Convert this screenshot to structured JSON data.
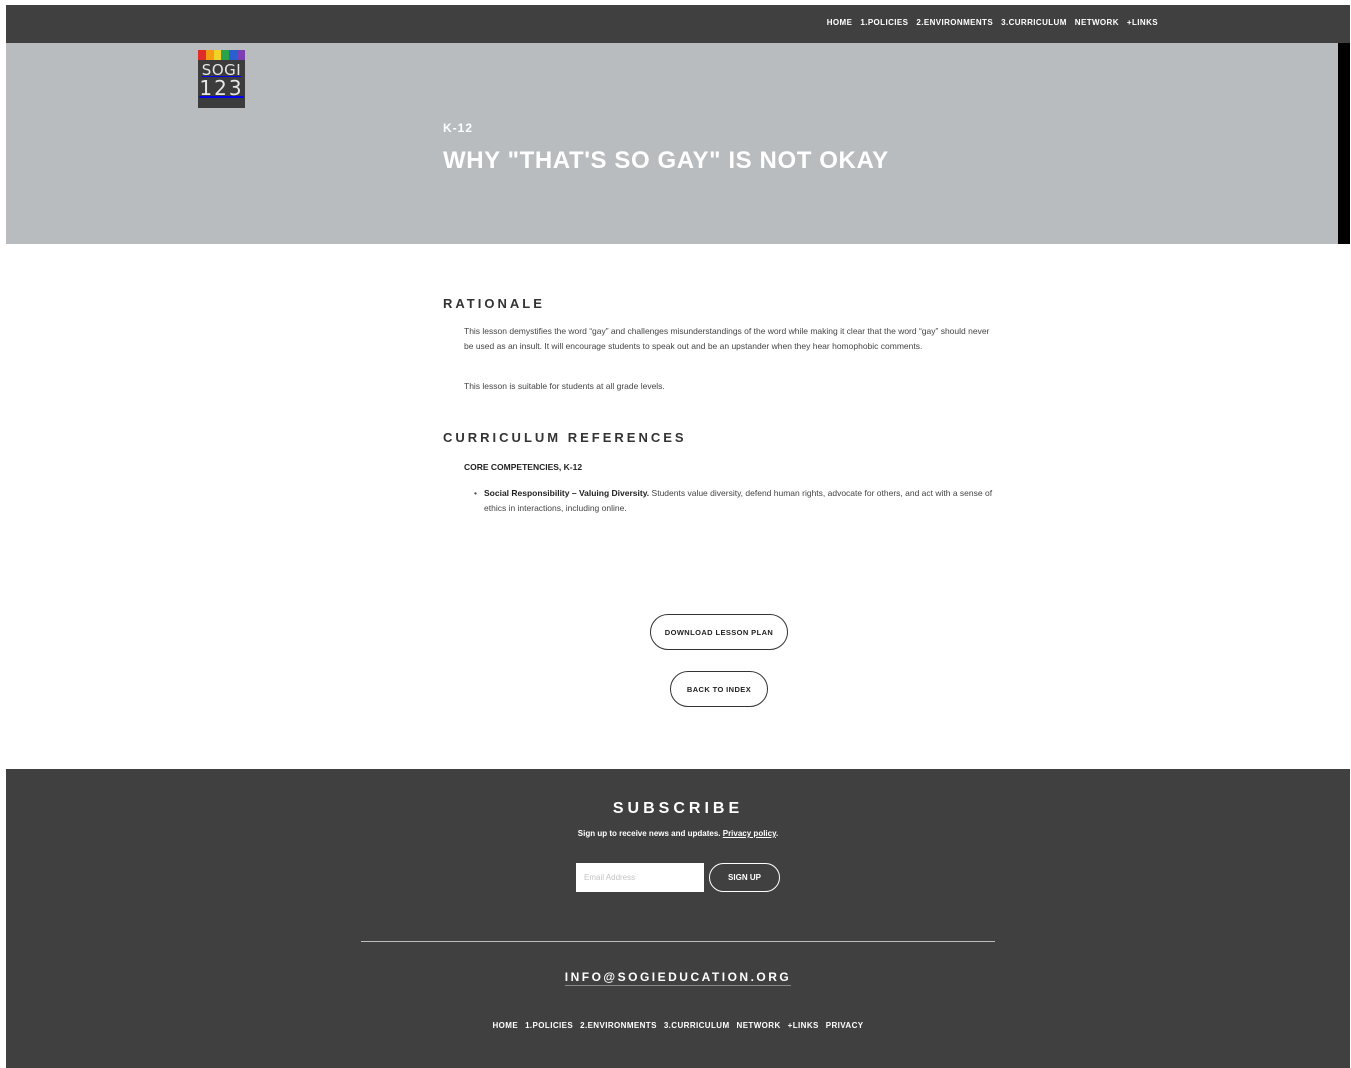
{
  "nav": {
    "items": [
      "HOME",
      "1.POLICIES",
      "2.ENVIRONMENTS",
      "3.CURRICULUM",
      "NETWORK",
      "+LINKS"
    ]
  },
  "logo": {
    "line1": "SOGI",
    "line2": "123",
    "stripe_colors": [
      "#e02b2b",
      "#f39c12",
      "#f1d22b",
      "#2ca24a",
      "#2a5fd0",
      "#7b3fb1"
    ]
  },
  "hero": {
    "kicker": "K-12",
    "title": "WHY \"THAT'S SO GAY\" IS NOT OKAY"
  },
  "rationale": {
    "heading": "RATIONALE",
    "paragraph1": "This lesson demystifies the word “gay” and challenges misunderstandings of the word while making it clear that the word “gay” should never be used as an insult. It will encourage students to speak out and be an upstander when they hear homophobic comments.",
    "paragraph2": "This lesson is suitable for students at all grade levels."
  },
  "curriculum": {
    "heading": "CURRICULUM REFERENCES",
    "subheading": "CORE COMPETENCIES, K-12",
    "bullet_bold": "Social Responsibility – Valuing Diversity.",
    "bullet_text": " Students value diversity, defend human rights, advocate for others, and act with a sense of ethics in interactions, including online."
  },
  "buttons": {
    "download": "DOWNLOAD LESSON PLAN",
    "back": "BACK TO INDEX"
  },
  "footer": {
    "subscribe_title": "SUBSCRIBE",
    "subscribe_text": "Sign up to receive news and updates.",
    "privacy_link": "Privacy policy",
    "email_placeholder": "Email Address",
    "signup_label": "SIGN UP",
    "email": "INFO@SOGIEDUCATION.ORG",
    "nav": [
      "HOME",
      "1.POLICIES",
      "2.ENVIRONMENTS",
      "3.CURRICULUM",
      "NETWORK",
      "+LINKS",
      "PRIVACY"
    ]
  },
  "colors": {
    "dark_bar": "#404040",
    "hero_bg": "#b8bcbf"
  }
}
